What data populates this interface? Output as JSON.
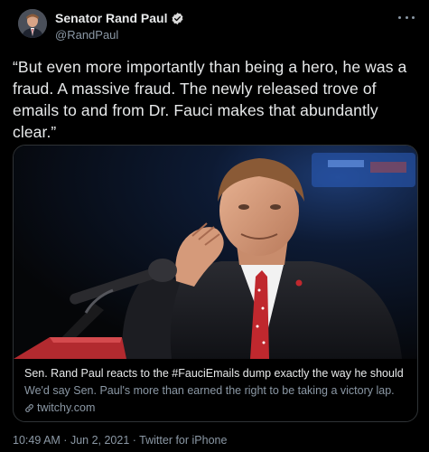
{
  "author": {
    "display_name": "Senator Rand Paul",
    "handle": "@RandPaul",
    "verified_icon": "verified-badge-icon"
  },
  "menu_icon": "more-icon",
  "tweet": {
    "text": "“But even more importantly than being a hero, he was a fraud. A massive fraud. The newly released trove of emails to and from Dr. Fauci makes that abundantly clear.”"
  },
  "card": {
    "title": "Sen. Rand Paul reacts to the #FauciEmails dump exactly the way he should",
    "description": "We'd say Sen. Paul's more than earned the right to be taking a victory lap.",
    "domain": "twitchy.com",
    "link_icon": "link-icon"
  },
  "meta": {
    "time": "10:49 AM",
    "date": "Jun 2, 2021",
    "source": "Twitter for iPhone",
    "separator": " · "
  },
  "colors": {
    "background": "#000000",
    "verified": "#d9d9d9",
    "secondary_text": "#8b98a5"
  }
}
